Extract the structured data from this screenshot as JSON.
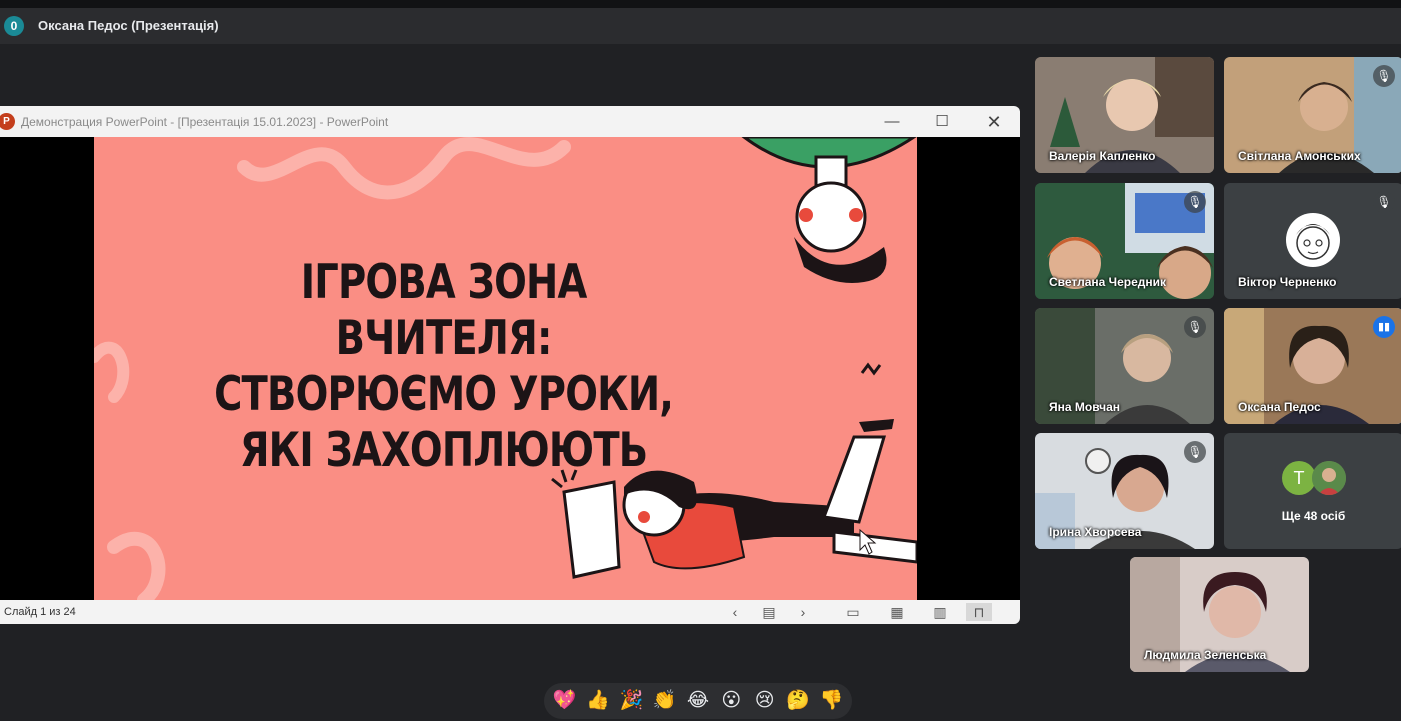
{
  "presenter": {
    "badge": "0",
    "title": "Оксана Педос (Презентація)"
  },
  "powerpoint": {
    "logo": "P",
    "window_title": "Демонстрация PowerPoint - [Презентація 15.01.2023] - PowerPoint",
    "slide_title": "ІГРОВА ЗОНА ВЧИТЕЛЯ:\nСТВОРЮЄМО УРОКИ,\nЯКІ ЗАХОПЛЮЮТЬ",
    "slide_counter": "Слайд 1 из 24",
    "slide_bg": "#fa8e84"
  },
  "participants": [
    {
      "name": "Валерія Капленко",
      "muted": false
    },
    {
      "name": "Світлана Амонських",
      "muted": true
    },
    {
      "name": "Светлана Чередник",
      "muted": true
    },
    {
      "name": "Віктор Черненко",
      "muted": true
    },
    {
      "name": "Яна Мовчан",
      "muted": true
    },
    {
      "name": "Оксана Педос",
      "muted": false,
      "speaking": true
    },
    {
      "name": "Ірина Хворсева",
      "muted": true
    },
    {
      "name": "Людмила Зеленська",
      "muted": false
    }
  ],
  "more": {
    "initial": "T",
    "label": "Ще 48 осіб"
  },
  "reactions": [
    "💖",
    "👍",
    "🎉",
    "👏",
    "😂",
    "😮",
    "😢",
    "🤔",
    "👎"
  ]
}
